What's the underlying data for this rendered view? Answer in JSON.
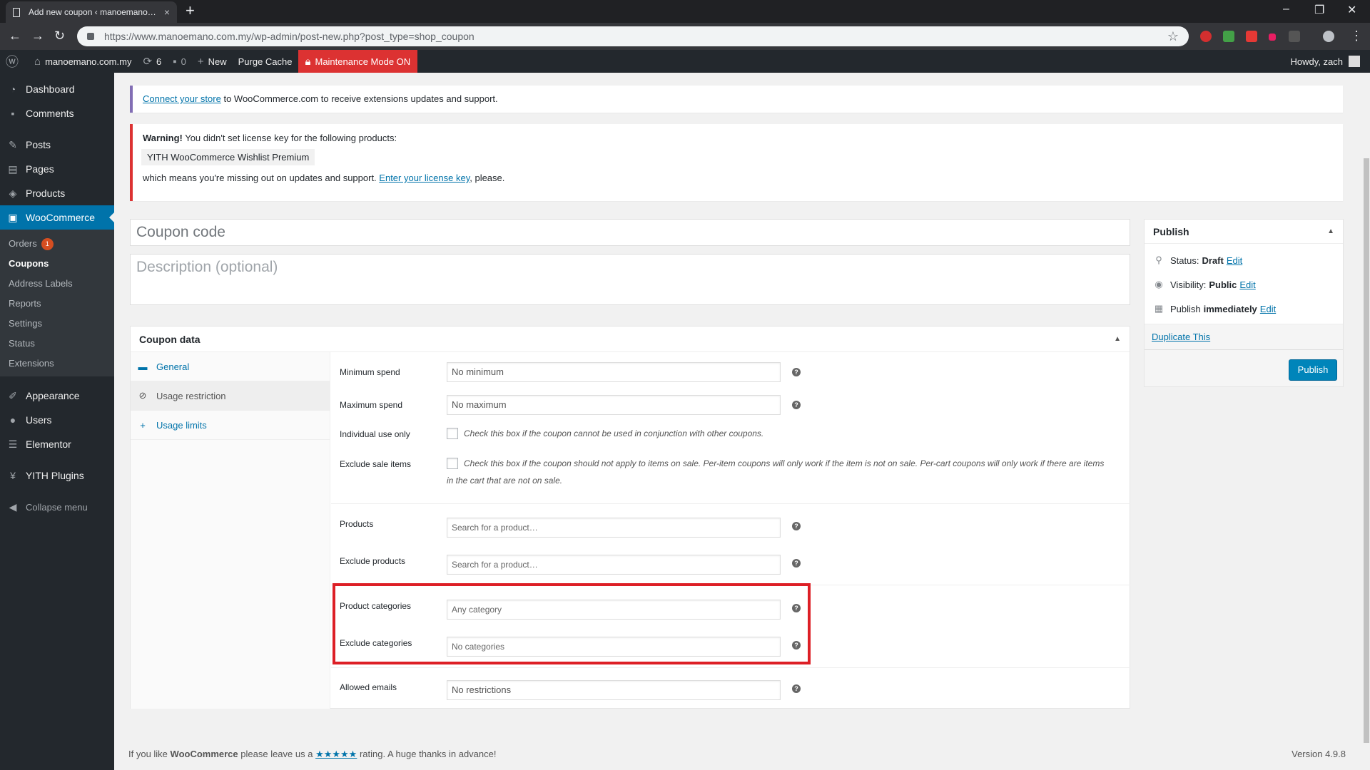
{
  "browser": {
    "tab_title": "Add new coupon ‹ manoemano…",
    "tab_close": "×",
    "new_tab": "+",
    "url": "https://www.manoemano.com.my/wp-admin/post-new.php?post_type=shop_coupon",
    "window_controls": [
      "–",
      "❐",
      "✕"
    ]
  },
  "adminbar": {
    "site_name": "manoemano.com.my",
    "updates_count": "6",
    "comments_count": "0",
    "new_label": "New",
    "purge_label": "Purge Cache",
    "maintenance_label": "Maintenance Mode ON",
    "howdy": "Howdy, zach"
  },
  "sidebar": {
    "items": [
      {
        "label": "Dashboard",
        "icon": "dashboard-icon"
      },
      {
        "label": "Comments",
        "icon": "comments-icon"
      },
      {
        "label": "Posts",
        "icon": "pin-icon"
      },
      {
        "label": "Pages",
        "icon": "pages-icon"
      },
      {
        "label": "Products",
        "icon": "box-icon"
      },
      {
        "label": "WooCommerce",
        "icon": "woo-icon"
      }
    ],
    "submenu": [
      {
        "label": "Orders",
        "badge": "1"
      },
      {
        "label": "Coupons"
      },
      {
        "label": "Address Labels"
      },
      {
        "label": "Reports"
      },
      {
        "label": "Settings"
      },
      {
        "label": "Status"
      },
      {
        "label": "Extensions"
      }
    ],
    "lower": [
      {
        "label": "Appearance",
        "icon": "brush-icon"
      },
      {
        "label": "Users",
        "icon": "user-icon"
      },
      {
        "label": "Elementor",
        "icon": "elementor-icon"
      },
      {
        "label": "YITH Plugins",
        "icon": "yith-icon"
      },
      {
        "label": "Collapse menu",
        "icon": "collapse-icon"
      }
    ]
  },
  "notices": {
    "connect_link": "Connect your store",
    "connect_text": " to WooCommerce.com to receive extensions updates and support.",
    "warning_bold": "Warning!",
    "warning_text": " You didn't set license key for the following products:",
    "product_chip": "YITH WooCommerce Wishlist Premium",
    "missing_text": "which means you're missing out on updates and support. ",
    "license_link": "Enter your license key",
    "please": ", please."
  },
  "coupon": {
    "code_placeholder": "Coupon code",
    "desc_placeholder": "Description (optional)"
  },
  "coupon_data": {
    "title": "Coupon data",
    "tabs": [
      {
        "label": "General",
        "icon": "ticket-icon"
      },
      {
        "label": "Usage restriction",
        "icon": "restriction-icon"
      },
      {
        "label": "Usage limits",
        "icon": "plus-icon"
      }
    ],
    "fields": {
      "min_spend_label": "Minimum spend",
      "min_spend_ph": "No minimum",
      "max_spend_label": "Maximum spend",
      "max_spend_ph": "No maximum",
      "individual_label": "Individual use only",
      "individual_text": "Check this box if the coupon cannot be used in conjunction with other coupons.",
      "exclude_sale_label": "Exclude sale items",
      "exclude_sale_text": "Check this box if the coupon should not apply to items on sale. Per-item coupons will only work if the item is not on sale. Per-cart coupons will only work if there are items in the cart that are not on sale.",
      "products_label": "Products",
      "products_ph": "Search for a product…",
      "exclude_products_label": "Exclude products",
      "exclude_products_ph": "Search for a product…",
      "product_cats_label": "Product categories",
      "product_cats_ph": "Any category",
      "exclude_cats_label": "Exclude categories",
      "exclude_cats_ph": "No categories",
      "emails_label": "Allowed emails",
      "emails_ph": "No restrictions"
    }
  },
  "publish": {
    "title": "Publish",
    "status_label": "Status:",
    "status_value": "Draft",
    "visibility_label": "Visibility:",
    "visibility_value": "Public",
    "publish_label": "Publish",
    "publish_value": "immediately",
    "edit": "Edit",
    "duplicate": "Duplicate This",
    "button": "Publish"
  },
  "footer": {
    "pre": "If you like ",
    "brand": "WooCommerce",
    "mid": " please leave us a ",
    "stars": "★★★★★",
    "post": " rating. A huge thanks in advance!",
    "version": "Version 4.9.8"
  },
  "colors": {
    "admin_bar": "#23282d",
    "accent": "#0073aa",
    "maintenance": "#dc3232",
    "highlight": "#dd1f26"
  }
}
